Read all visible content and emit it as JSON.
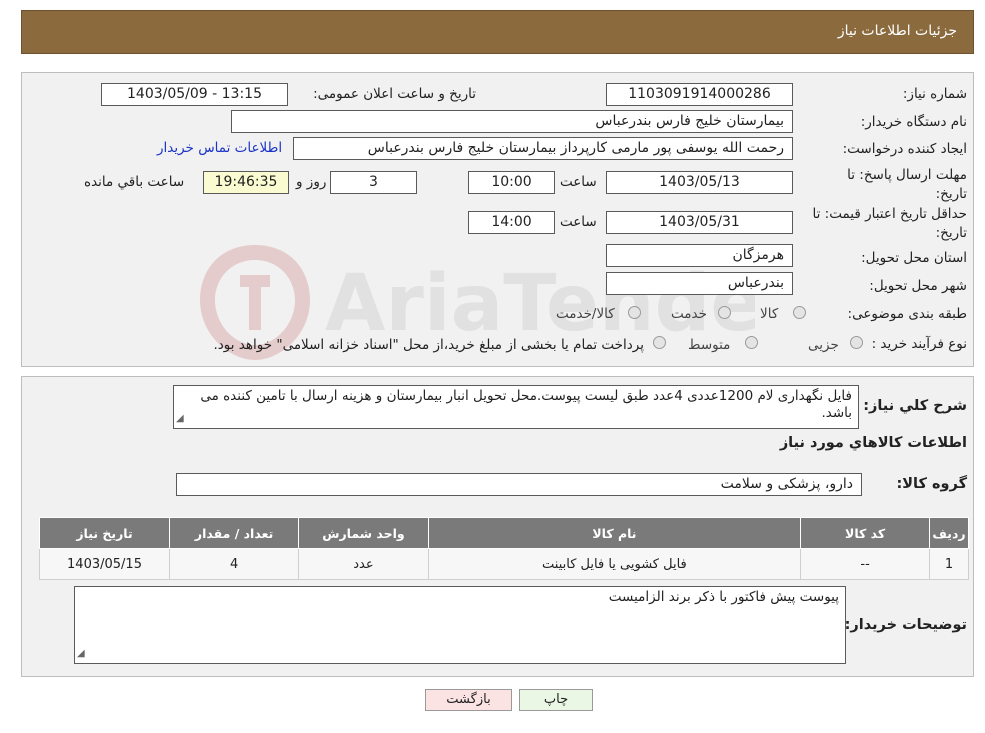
{
  "header": {
    "title": "جزئیات اطلاعات نیاز"
  },
  "form": {
    "need_number_label": "شماره نیاز:",
    "need_number": "1103091914000286",
    "announce_label": "تاریخ و ساعت اعلان عمومی:",
    "announce_value": "1403/05/09 - 13:15",
    "buyer_org_label": "نام دستگاه خریدار:",
    "buyer_org": "بیمارستان خلیج فارس بندرعباس",
    "creator_label": "ایجاد کننده درخواست:",
    "creator": "رحمت الله یوسفی پور مارمی کارپرداز بیمارستان خلیج فارس بندرعباس",
    "contact_link": "اطلاعات تماس خریدار",
    "reply_deadline_label_1": "مهلت ارسال پاسخ: تا",
    "reply_deadline_label_2": "تاریخ:",
    "reply_date": "1403/05/13",
    "time_label": "ساعت",
    "reply_time": "10:00",
    "days_value": "3",
    "days_label": "روز و",
    "remaining_time": "19:46:35",
    "remaining_label": "ساعت باقي مانده",
    "price_validity_label_1": "حداقل تاریخ اعتبار قیمت: تا",
    "price_validity_label_2": "تاریخ:",
    "price_date": "1403/05/31",
    "price_time": "14:00",
    "province_label": "استان محل تحویل:",
    "province": "هرمزگان",
    "city_label": "شهر محل تحویل:",
    "city": "بندرعباس",
    "category_label": "طبقه بندی موضوعی:",
    "category_options": [
      "کالا",
      "خدمت",
      "کالا/خدمت"
    ],
    "process_label": "نوع فرآیند خرید :",
    "process_options": [
      "جزیی",
      "متوسط"
    ],
    "process_note": "پرداخت تمام یا بخشی از مبلغ خرید،از محل \"اسناد خزانه اسلامی\" خواهد بود."
  },
  "details": {
    "summary_label": "شرح کلي نياز:",
    "summary": "فایل نگهداری لام 1200عددی 4عدد طبق لیست پیوست.محل تحویل انبار بیمارستان و هزینه ارسال با تامین کننده می باشد.",
    "items_heading": "اطلاعات کالاهاي مورد نياز",
    "group_label": "گروه کالا:",
    "group": "دارو، پزشکی و سلامت",
    "table": {
      "headers": [
        "رديف",
        "کد کالا",
        "نام کالا",
        "واحد شمارش",
        "تعداد / مقدار",
        "تاریخ نیاز"
      ],
      "rows": [
        [
          "1",
          "--",
          "فایل کشویی یا فایل کابینت",
          "عدد",
          "4",
          "1403/05/15"
        ]
      ]
    },
    "buyer_notes_label": "توضیحات خریدار:",
    "buyer_notes": "پیوست پیش فاکتور با ذکر برند الزامیست"
  },
  "buttons": {
    "print": "چاپ",
    "back": "بازگشت"
  },
  "watermark": {
    "text": "AriaTender.neT"
  }
}
